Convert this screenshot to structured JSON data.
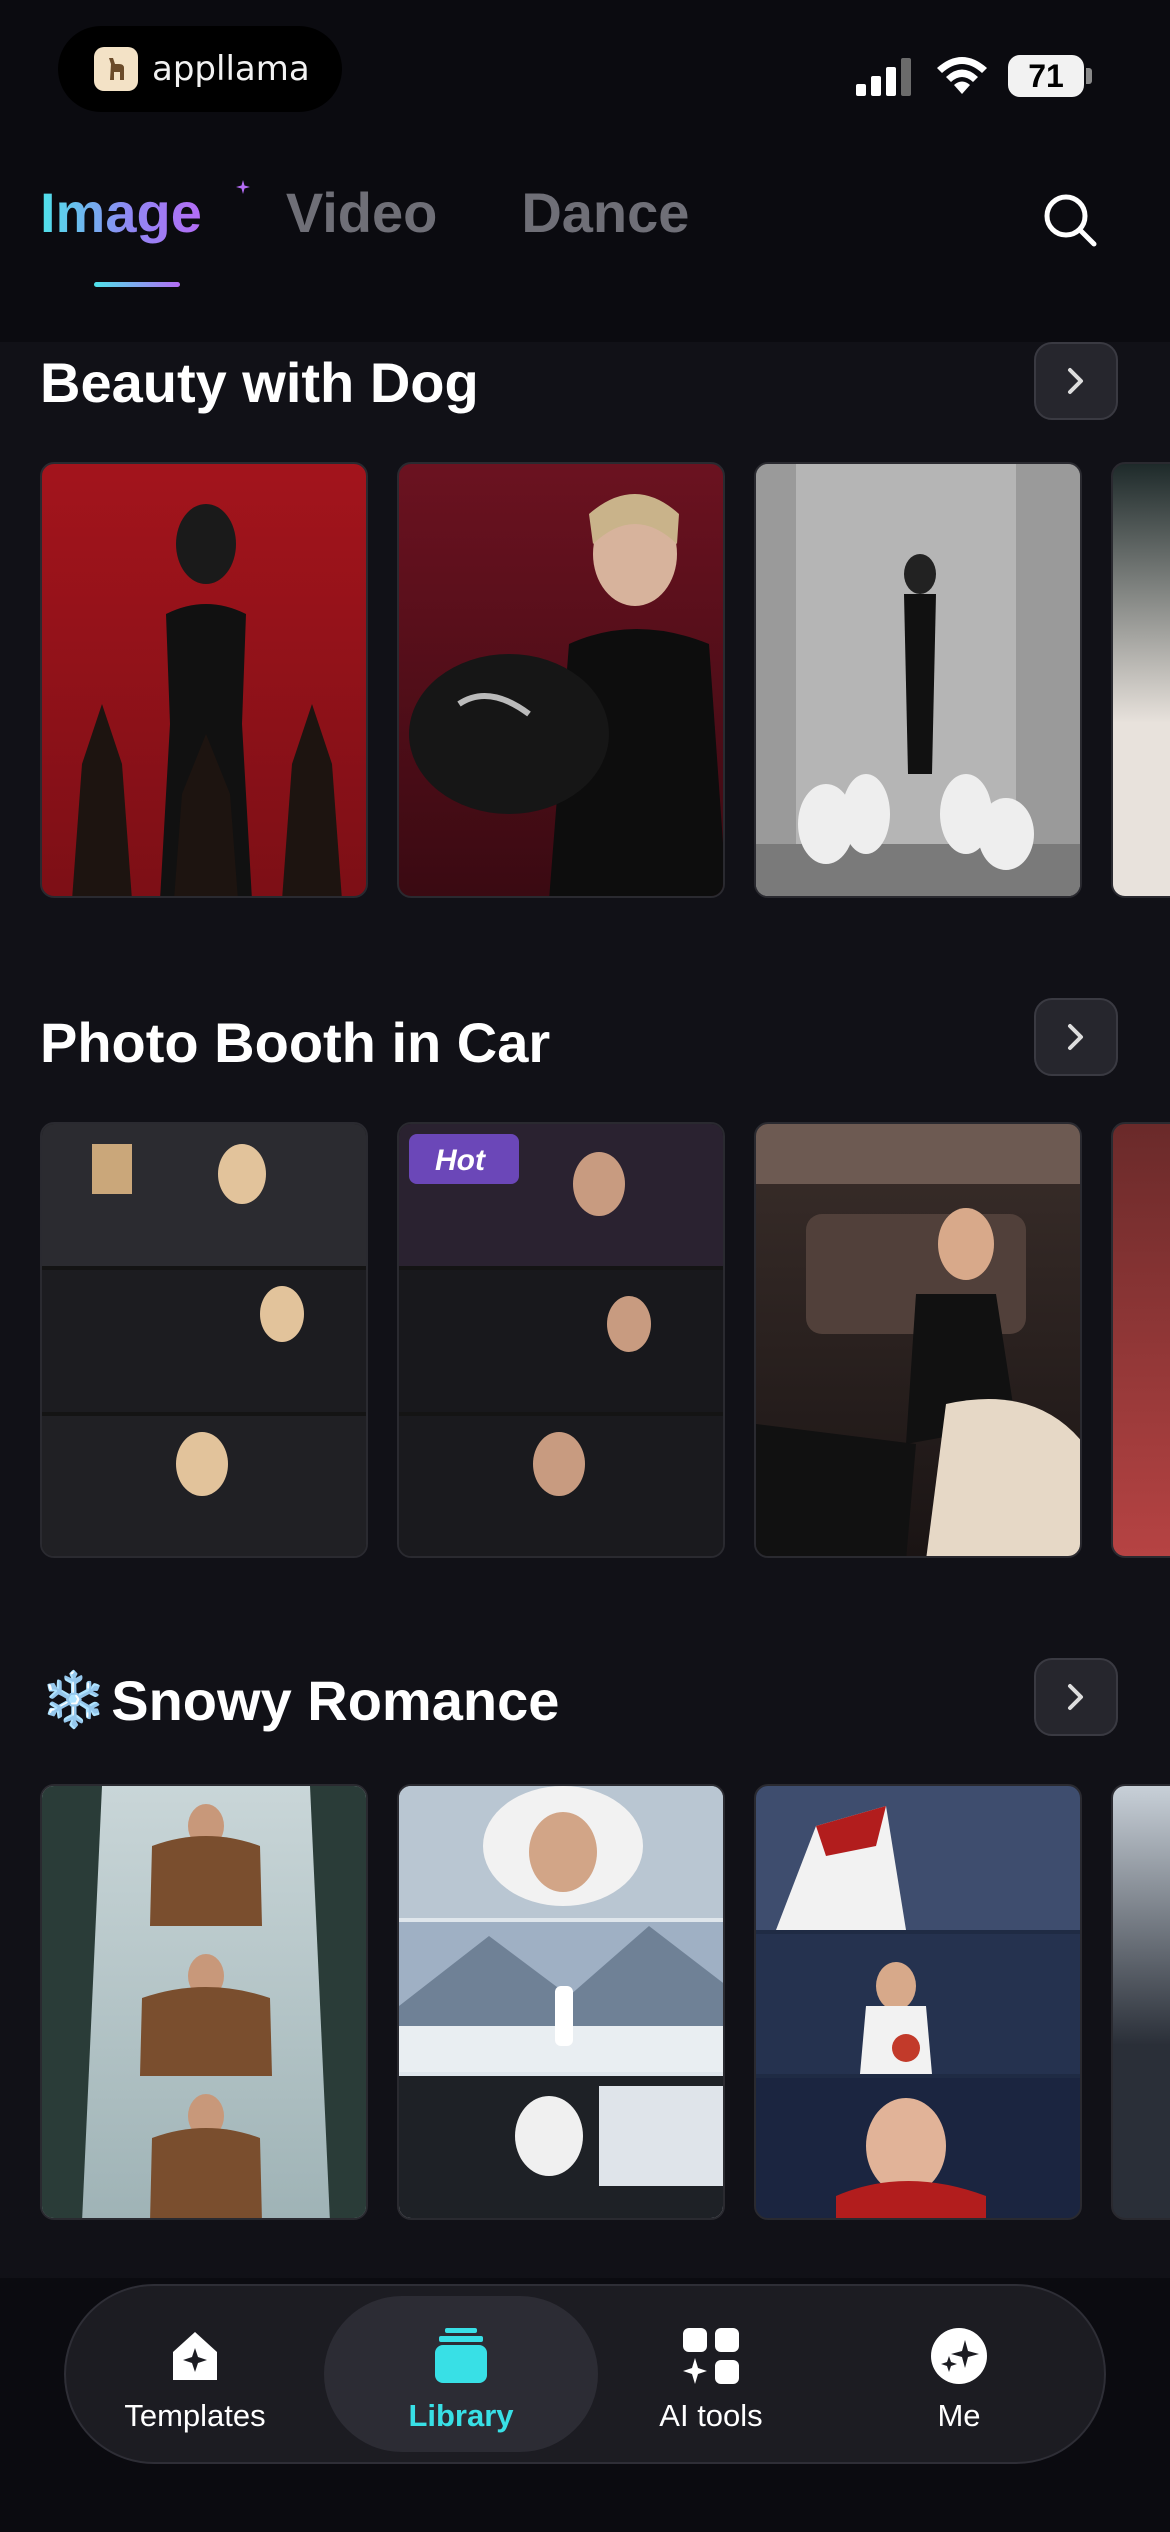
{
  "status": {
    "app_name": "appllama",
    "battery": "71"
  },
  "tabs": [
    {
      "label": "Image",
      "active": true
    },
    {
      "label": "Video",
      "active": false
    },
    {
      "label": "Dance",
      "active": false
    }
  ],
  "sections": [
    {
      "title": "Beauty with Dog",
      "emoji": ""
    },
    {
      "title": "Photo Booth in Car",
      "emoji": ""
    },
    {
      "title": "Snowy Romance",
      "emoji": "❄️"
    }
  ],
  "badges": {
    "hot": "Hot"
  },
  "nav": [
    {
      "label": "Templates",
      "icon": "templates-icon",
      "active": false
    },
    {
      "label": "Library",
      "icon": "library-icon",
      "active": true
    },
    {
      "label": "AI tools",
      "icon": "ai-tools-icon",
      "active": false
    },
    {
      "label": "Me",
      "icon": "me-icon",
      "active": false
    }
  ],
  "colors": {
    "accent": "#38e0e6",
    "gradient_start": "#4ee3ea",
    "gradient_end": "#b46cf5",
    "background": "#0b0b10"
  }
}
